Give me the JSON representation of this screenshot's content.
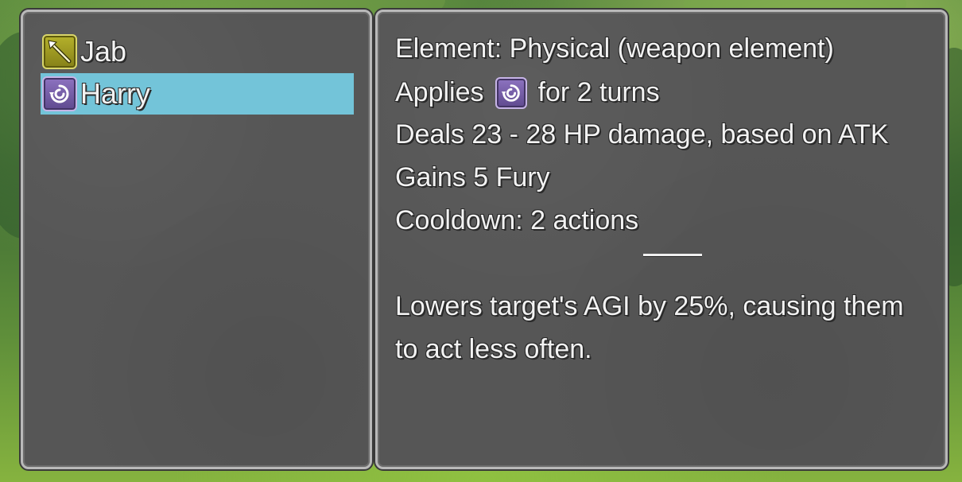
{
  "skills": [
    {
      "name": "Jab",
      "icon": "spear-icon",
      "selected": false
    },
    {
      "name": "Harry",
      "icon": "swirl-debuff-icon",
      "selected": true
    }
  ],
  "details": {
    "element": "Element: Physical (weapon element)",
    "applies_prefix": "Applies",
    "applies_suffix": "for 2 turns",
    "applies_icon": "swirl-debuff-icon",
    "damage": "Deals 23 - 28 HP damage, based on ATK",
    "fury": "Gains 5 Fury",
    "cooldown": "Cooldown: 2 actions",
    "description_line1": "Lowers target's AGI by 25%, causing them",
    "description_line2": "to act less often."
  },
  "colors": {
    "selection_highlight": "#73c4d9",
    "panel_background": "#565656",
    "text": "#f2f2f2",
    "jab_icon_bg": "#9d9922",
    "harry_icon_bg": "#6f58a3"
  }
}
